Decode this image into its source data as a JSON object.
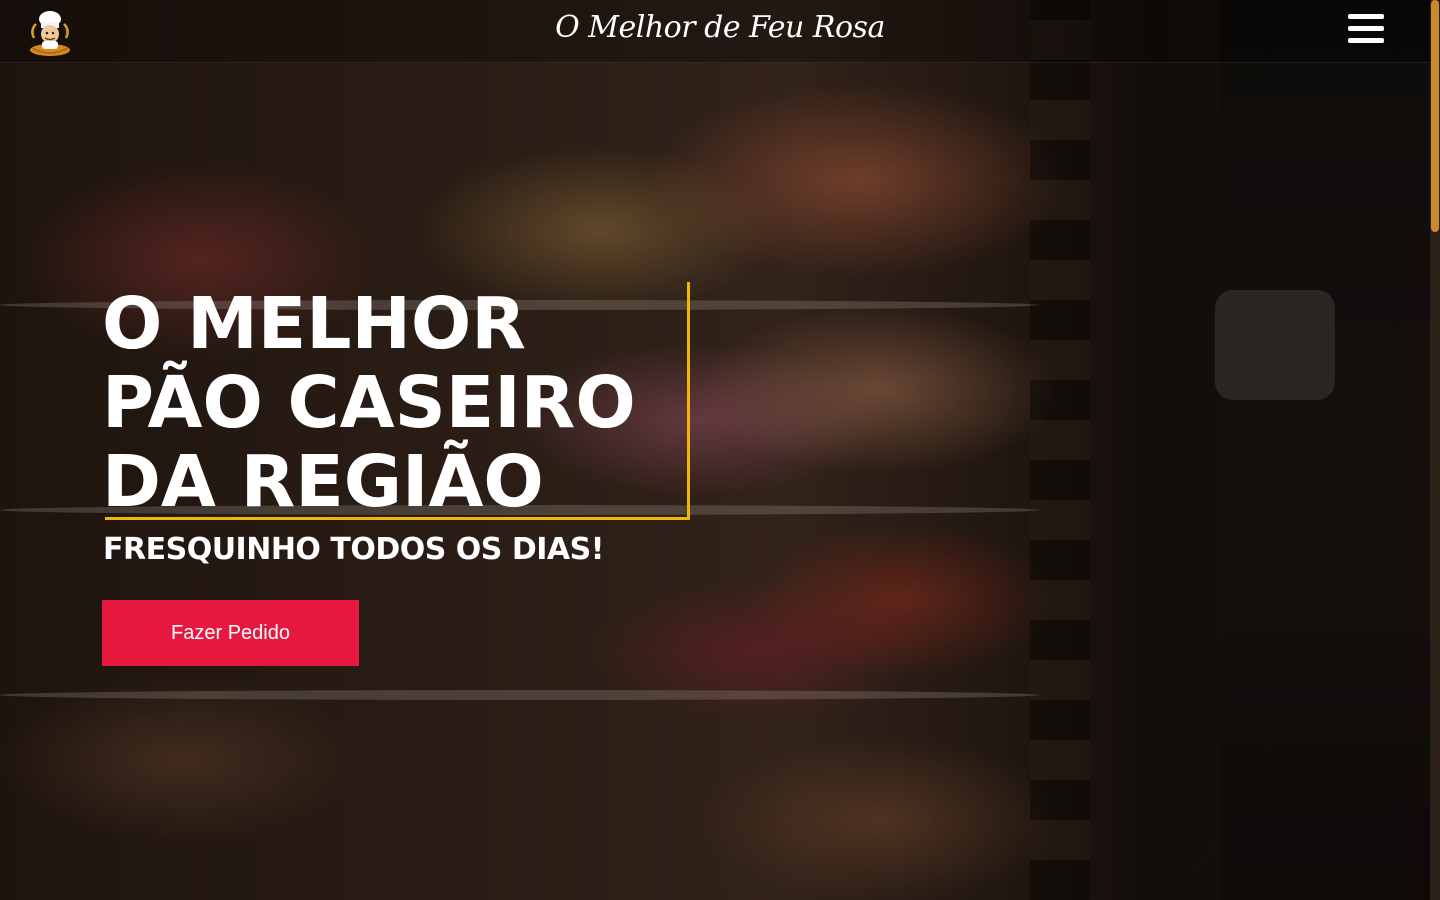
{
  "header": {
    "brand": "O Melhor de Feu Rosa",
    "logo_icon": "baker-chef-logo-icon",
    "menu_icon": "hamburger-menu-icon"
  },
  "hero": {
    "title_lines": [
      "O MELHOR",
      "PÃO CASEIRO",
      "DA REGIÃO"
    ],
    "tagline": "FRESQUINHO TODOS OS DIAS!",
    "cta_label": "Fazer Pedido"
  },
  "colors": {
    "accent_yellow": "#f2b705",
    "cta_red": "#e8173f",
    "scrollbar_thumb": "#c98a2c",
    "text": "#ffffff"
  }
}
